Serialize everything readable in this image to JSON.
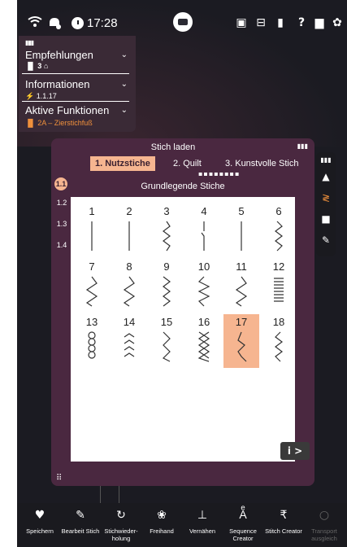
{
  "status": {
    "time": "17:28"
  },
  "left_panel": {
    "recommendations_label": "Empfehlungen",
    "recommendations_count": "3",
    "info_label": "Informationen",
    "info_version": "1.1.17",
    "active_label": "Aktive Funktionen",
    "active_value": "2A – Zierstichfuß"
  },
  "dialog": {
    "title": "Stich laden",
    "tabs": [
      {
        "label": "1. Nutzstiche"
      },
      {
        "label": "2. Quilt"
      },
      {
        "label": "3. Kunstvolle Stich"
      }
    ],
    "subheading": "Grundlegende Stiche",
    "categories": [
      "1.1",
      "1.2",
      "1.3",
      "1.4"
    ],
    "stitches": [
      "1",
      "2",
      "3",
      "4",
      "5",
      "6",
      "7",
      "8",
      "9",
      "10",
      "11",
      "12",
      "13",
      "14",
      "15",
      "16",
      "17",
      "18"
    ],
    "selected_stitch": "17",
    "info_icon": "i",
    "info_arrow": ">"
  },
  "bottom_bar": [
    {
      "label": "Speichern",
      "icon": "heart-icon"
    },
    {
      "label": "Bearbeit Stich",
      "icon": "edit-stitch-icon"
    },
    {
      "label": "Stichwieder-holung",
      "icon": "repeat-icon"
    },
    {
      "label": "Freihand",
      "icon": "freehand-icon"
    },
    {
      "label": "Vernähen",
      "icon": "tie-off-icon"
    },
    {
      "label": "Sequence Creator",
      "icon": "sequence-icon"
    },
    {
      "label": "Stitch Creator",
      "icon": "stitch-creator-icon"
    },
    {
      "label": "Transport ausgleich",
      "icon": "feed-balance-icon"
    }
  ],
  "colors": {
    "accent": "#f6b590",
    "panel": "#4a2840",
    "orange": "#f1913c",
    "background": "#1b1b22"
  }
}
